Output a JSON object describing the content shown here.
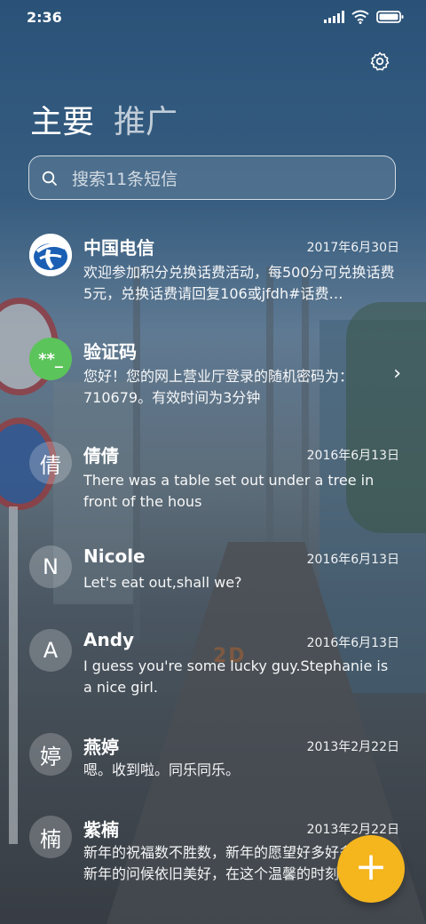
{
  "status": {
    "time": "2:36",
    "battery_icon": "battery-icon",
    "wifi_icon": "wifi-icon",
    "signal_icon": "signal-icon"
  },
  "header": {
    "settings_icon": "gear-icon",
    "tabs": [
      {
        "label": "主要",
        "active": true
      },
      {
        "label": "推广",
        "active": false
      }
    ]
  },
  "search": {
    "placeholder": "搜索11条短信",
    "value": ""
  },
  "messages": [
    {
      "name": "中国电信",
      "date": "2017年6月30日",
      "preview": "欢迎参加积分兑换话费活动，每500分可兑换话费5元，兑换话费请回复106或jfdh#话费…",
      "avatar": ""
    },
    {
      "name": "验证码",
      "date": "",
      "preview": "您好！您的网上营业厅登录的随机密码为：710679。有效时间为3分钟",
      "avatar": "**_"
    },
    {
      "name": "倩倩",
      "date": "2016年6月13日",
      "preview": "There was a table set out under a tree in front of the hous",
      "avatar": "倩"
    },
    {
      "name": "Nicole",
      "date": "2016年6月13日",
      "preview": "Let's eat out,shall we?",
      "avatar": "N"
    },
    {
      "name": "Andy",
      "date": "2016年6月13日",
      "preview": "I guess you're some lucky guy.Stephanie is a nice girl.",
      "avatar": "A"
    },
    {
      "name": "燕婷",
      "date": "2013年2月22日",
      "preview": "嗯。收到啦。同乐同乐。",
      "avatar": "婷"
    },
    {
      "name": "紫楠",
      "date": "2013年2月22日",
      "preview": "新年的祝福数不胜数，新年的愿望好多好多，新年的问候依旧美好，在这个温馨的时刻",
      "avatar": "楠"
    }
  ],
  "fab": {
    "label": "+"
  },
  "colors": {
    "fab": "#f5b51d",
    "code_avatar": "#5bc45a",
    "telecom_blue": "#1b5fb4"
  }
}
